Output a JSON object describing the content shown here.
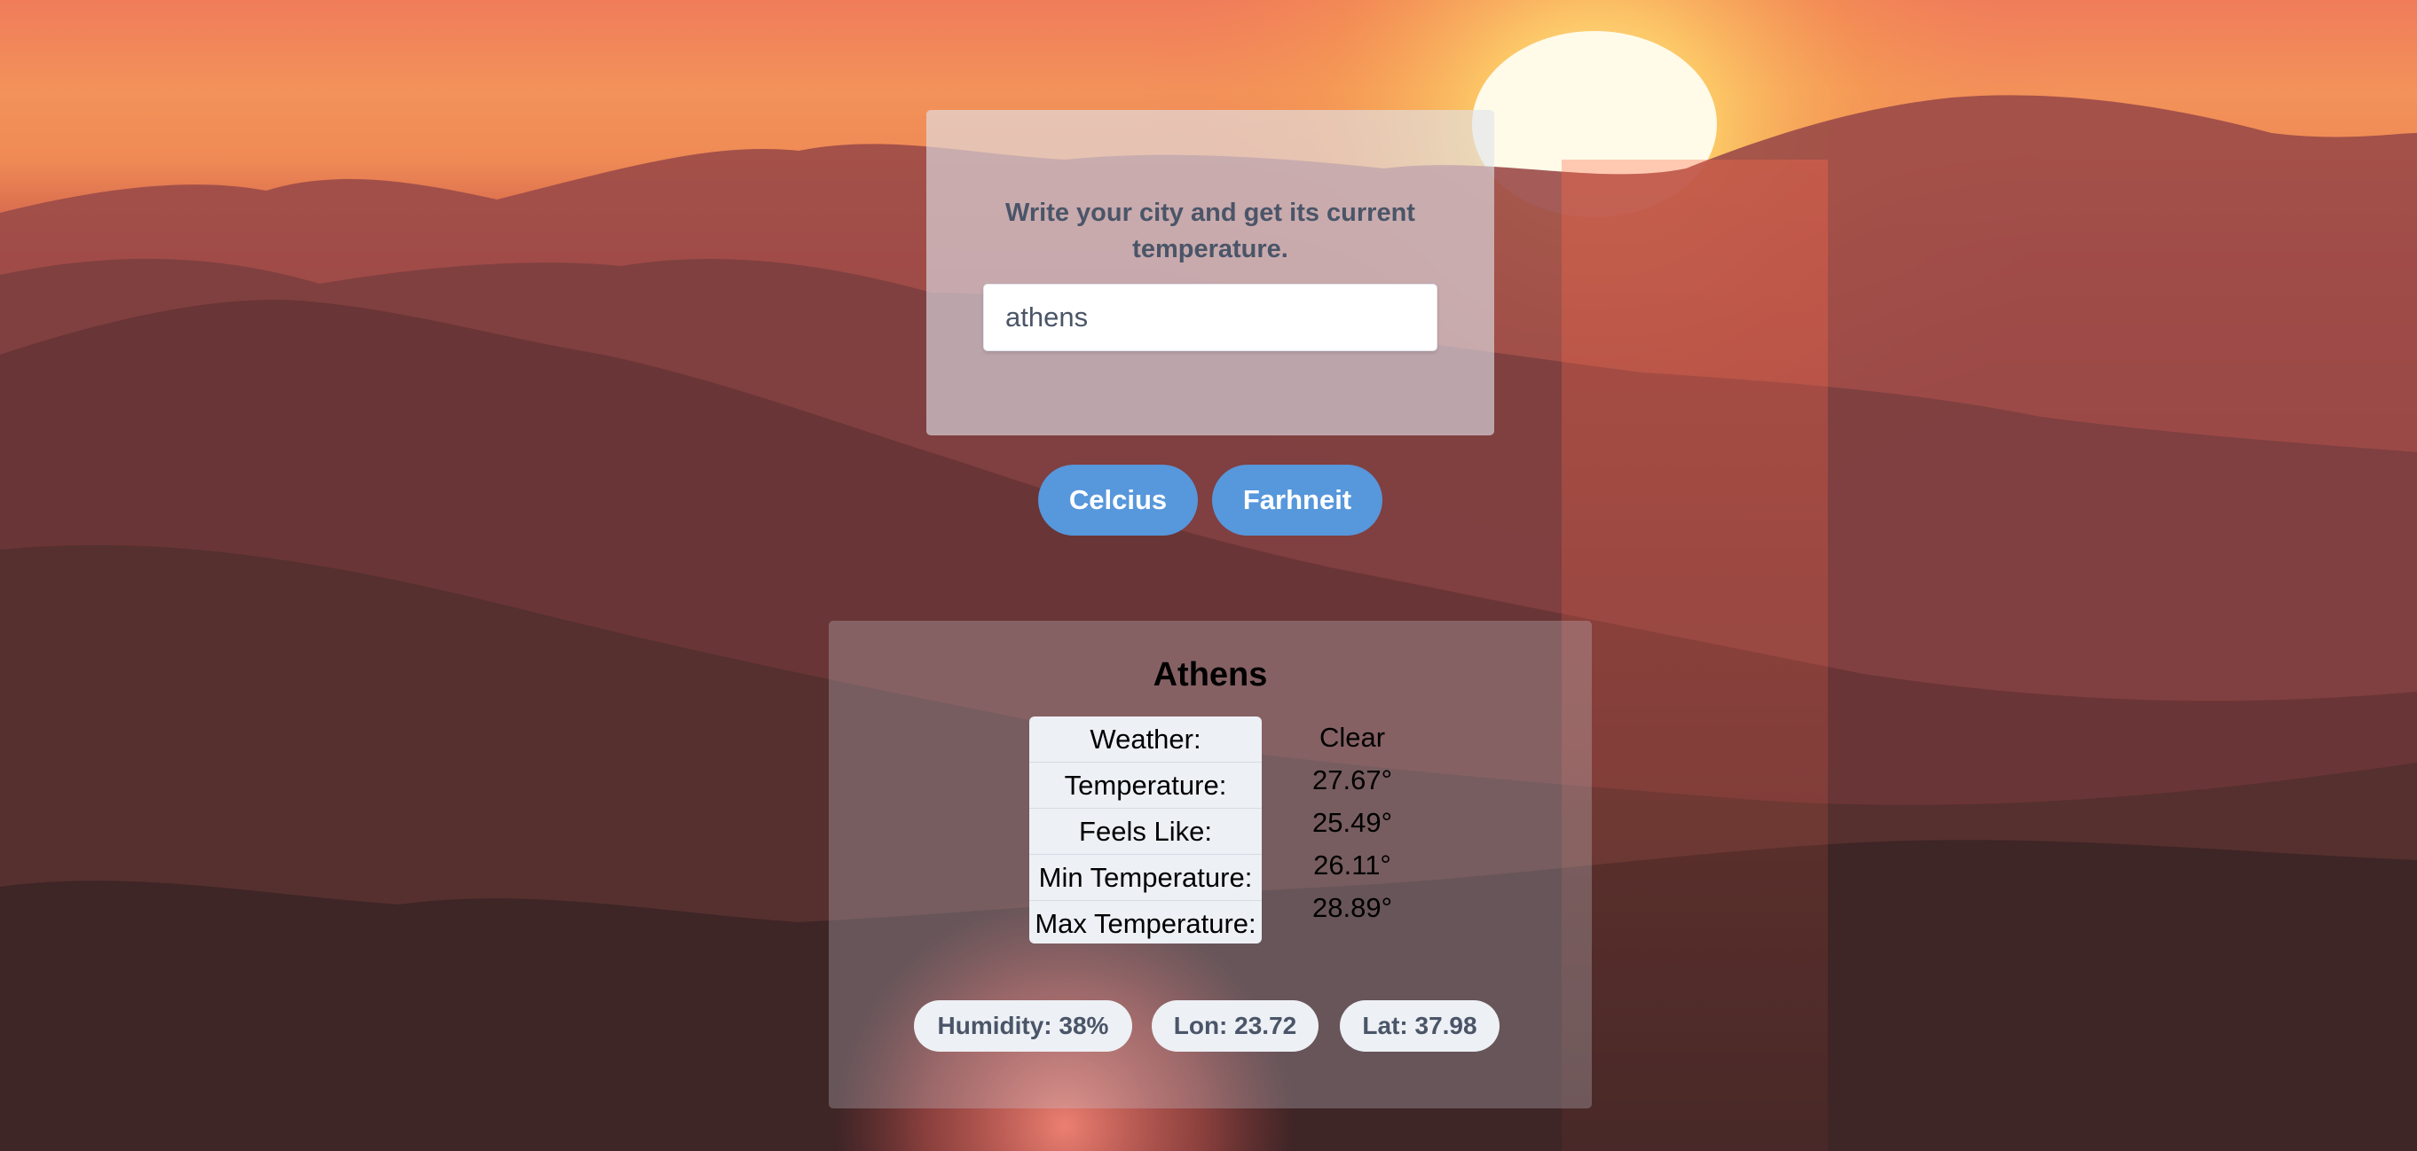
{
  "search": {
    "prompt": "Write your city and get its current temperature.",
    "value": "athens",
    "placeholder": ""
  },
  "units": {
    "celsius_label": "Celcius",
    "fahrenheit_label": "Farhneit"
  },
  "result": {
    "city": "Athens",
    "rows": [
      {
        "label": "Weather:",
        "value": "Clear"
      },
      {
        "label": "Temperature:",
        "value": "27.67°"
      },
      {
        "label": "Feels Like:",
        "value": "25.49°"
      },
      {
        "label": "Min Temperature:",
        "value": "26.11°"
      },
      {
        "label": "Max Temperature:",
        "value": "28.89°"
      }
    ],
    "humidity": "Humidity: 38%",
    "lon": "Lon: 23.72",
    "lat": "Lat: 37.98"
  },
  "colors": {
    "button": "#5797db",
    "pill_bg": "#edf0f5",
    "muted_text": "#4a5568"
  }
}
